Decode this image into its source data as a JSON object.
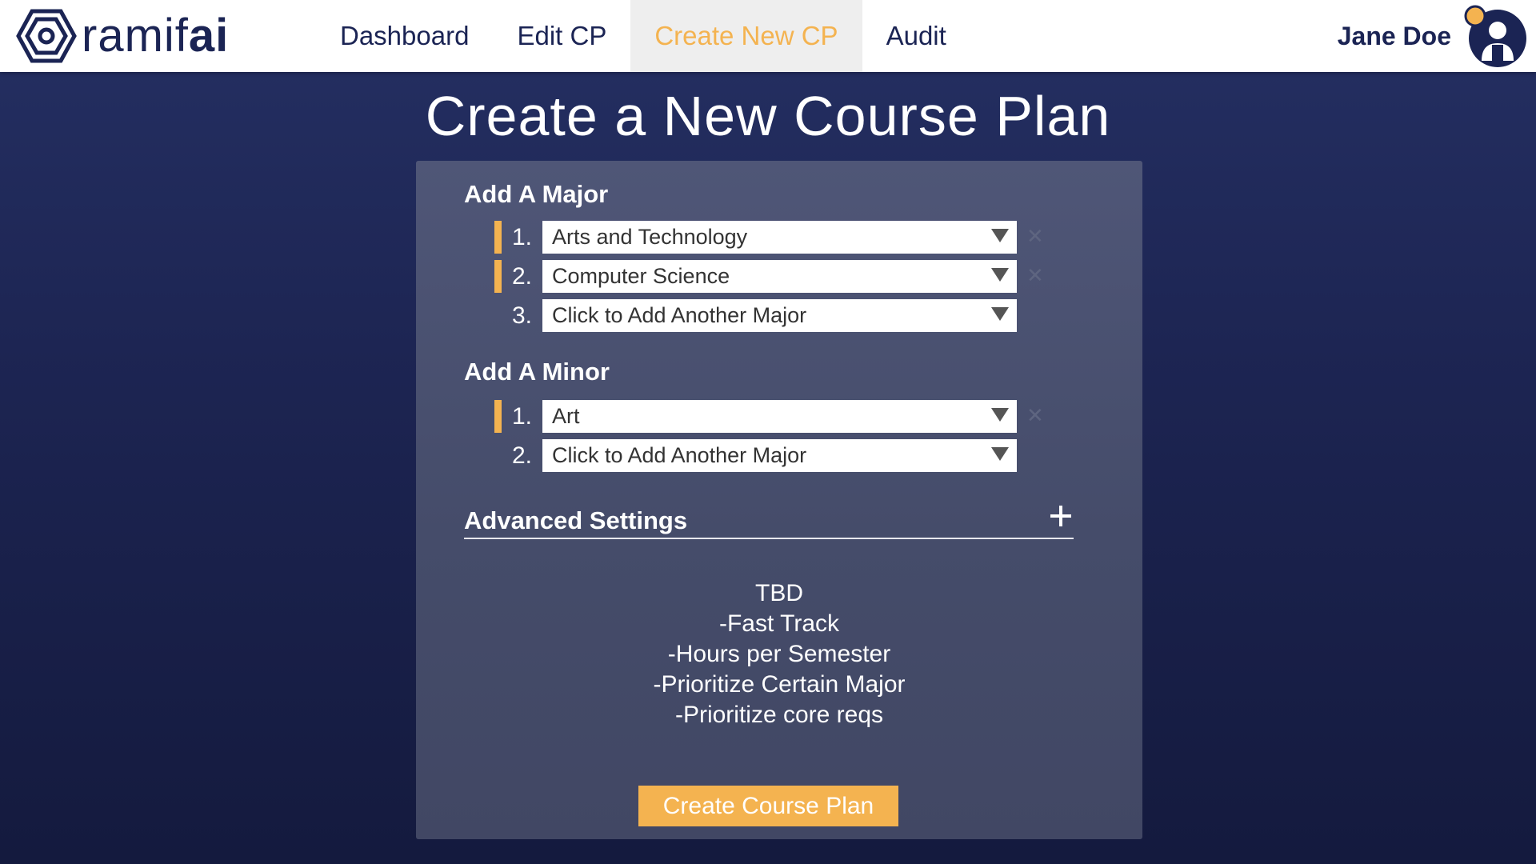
{
  "brand": {
    "name_light": "ramif",
    "name_bold": "ai"
  },
  "nav": {
    "items": [
      {
        "label": "Dashboard"
      },
      {
        "label": "Edit CP"
      },
      {
        "label": "Create New CP"
      },
      {
        "label": "Audit"
      }
    ],
    "active": "Create New CP"
  },
  "user": {
    "name": "Jane Doe",
    "icon": "user-avatar-icon",
    "status_color": "#f4b350"
  },
  "page": {
    "title": "Create a New Course Plan"
  },
  "majors": {
    "title": "Add A Major",
    "items": [
      {
        "num": "1.",
        "value": "Arts and Technology",
        "selected": true
      },
      {
        "num": "2.",
        "value": "Computer Science",
        "selected": true
      },
      {
        "num": "3.",
        "value": "Click to Add Another Major",
        "selected": false
      }
    ]
  },
  "minors": {
    "title": "Add A Minor",
    "items": [
      {
        "num": "1.",
        "value": "Art",
        "selected": true
      },
      {
        "num": "2.",
        "value": "Click to Add Another Major",
        "selected": false
      }
    ]
  },
  "advanced": {
    "title": "Advanced Settings",
    "notes": [
      "TBD",
      "-Fast Track",
      "-Hours per Semester",
      "-Prioritize Certain Major",
      "-Prioritize core reqs"
    ]
  },
  "actions": {
    "create_label": "Create Course Plan"
  },
  "colors": {
    "accent": "#f4b350",
    "brand": "#1b2454",
    "panel": "#4b5272"
  }
}
